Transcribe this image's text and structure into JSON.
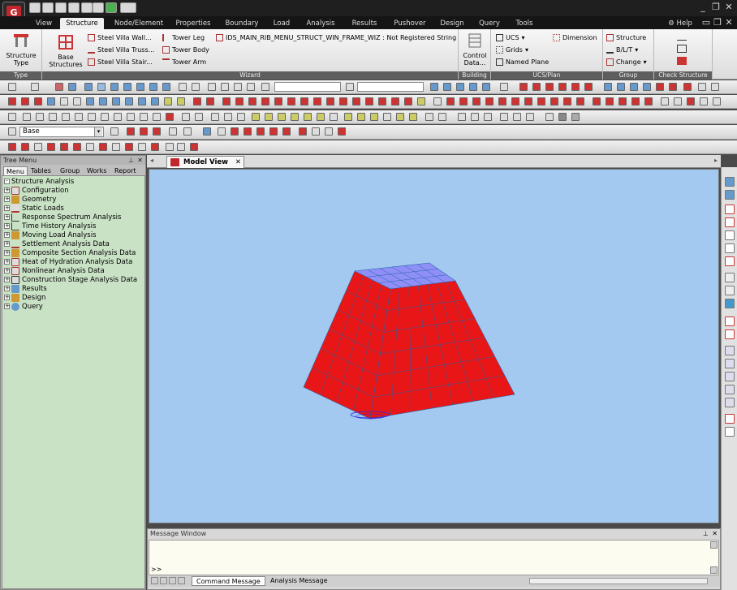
{
  "app": {
    "logo": "G"
  },
  "menu": {
    "tabs": [
      "View",
      "Structure",
      "Node/Element",
      "Properties",
      "Boundary",
      "Load",
      "Analysis",
      "Results",
      "Pushover",
      "Design",
      "Query",
      "Tools"
    ],
    "help": "Help"
  },
  "ribbon": {
    "type": {
      "button": "Structure Type",
      "group": "Type"
    },
    "wizard": {
      "base": "Base Structures",
      "wall": "Steel Villa Wall...",
      "truss": "Steel Villa Truss...",
      "stair": "Steel Villa Stair...",
      "leg": "Tower Leg",
      "body": "Tower Body",
      "arm": "Tower Arm",
      "frame": "IDS_MAIN_RIB_MENU_STRUCT_WIN_FRAME_WIZ : Not Registered String",
      "group": "Wizard"
    },
    "building": {
      "button": "Control Data...",
      "group": "Building"
    },
    "ucs": {
      "ucs": "UCS",
      "grids": "Grids",
      "named": "Named Plane",
      "dimension": "Dimension",
      "group": "UCS/Plan"
    },
    "grp": {
      "structure": "Structure",
      "blt": "B/L/T",
      "change": "Change",
      "group": "Group"
    },
    "check": {
      "group": "Check Structure"
    }
  },
  "toolbar": {
    "base_value": "Base"
  },
  "tree": {
    "title": "Tree Menu",
    "tabs": [
      "Menu",
      "Tables",
      "Group",
      "Works",
      "Report"
    ],
    "root": "Structure Analysis",
    "items": [
      "Configuration",
      "Geometry",
      "Static Loads",
      "Response Spectrum Analysis",
      "Time History Analysis",
      "Moving Load Analysis",
      "Settlement Analysis Data",
      "Composite Section Analysis Data",
      "Heat of Hydration Analysis Data",
      "Nonlinear Analysis Data",
      "Construction Stage Analysis Data",
      "Results",
      "Design",
      "Query"
    ]
  },
  "view": {
    "tab": "Model View"
  },
  "message": {
    "title": "Message Window",
    "prompt": ">>",
    "tabs": [
      "Command Message",
      "Analysis Message"
    ]
  },
  "colors": {
    "mesh": "#e81616",
    "top": "#8f8ff8",
    "viewport": "#a3c9f0"
  }
}
